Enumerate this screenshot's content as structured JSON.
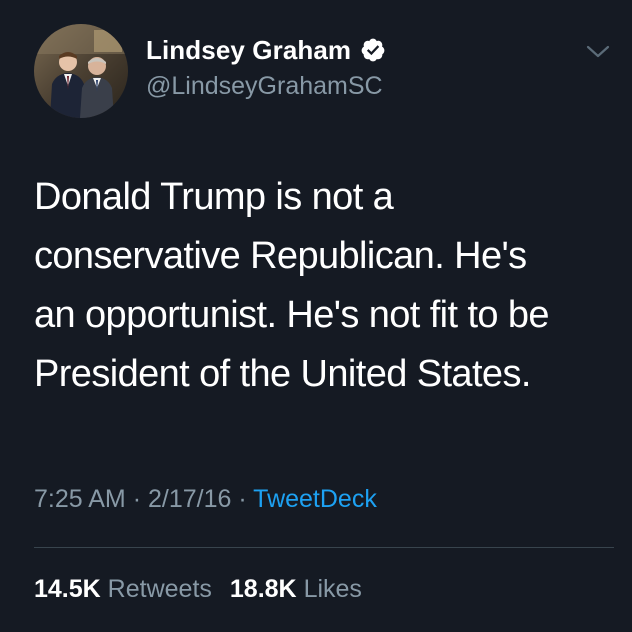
{
  "author": {
    "display_name": "Lindsey Graham",
    "handle": "@LindseyGrahamSC",
    "verified": true
  },
  "tweet": {
    "lines": [
      "Donald Trump is not a",
      "conservative Republican. He's",
      "an opportunist. He's not fit to be",
      "President of the United States."
    ],
    "time": "7:25 AM",
    "date": "2/17/16",
    "separator": "·",
    "client": "TweetDeck"
  },
  "stats": {
    "retweets_count": "14.5K",
    "retweets_label": "Retweets",
    "likes_count": "18.8K",
    "likes_label": "Likes"
  },
  "icons": {
    "verified": "verified-badge-icon",
    "menu": "chevron-down-icon"
  },
  "colors": {
    "background": "#151a23",
    "text": "#ffffff",
    "secondary": "#8899a6",
    "link": "#1da1f2",
    "divider": "#38444d"
  }
}
